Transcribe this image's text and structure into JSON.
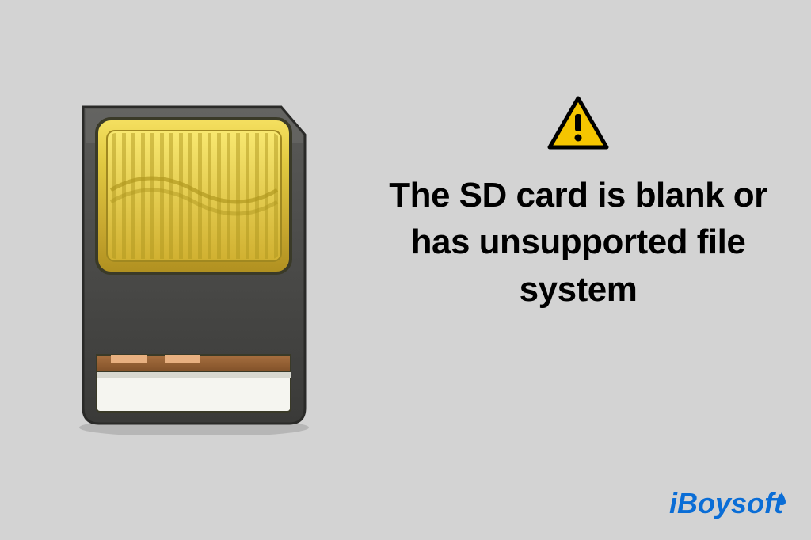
{
  "message": "The SD card is blank or has unsupported file system",
  "brand": {
    "prefix": "i",
    "name": "Boysoft"
  },
  "icons": {
    "sd_card": "sd-card-icon",
    "warning": "warning-triangle-icon",
    "water_drop": "water-drop-icon"
  }
}
